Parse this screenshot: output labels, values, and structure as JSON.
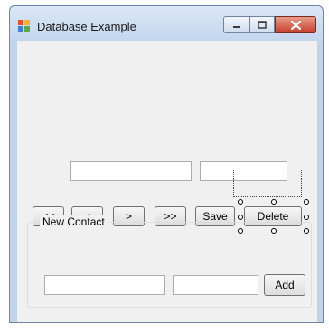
{
  "window": {
    "title": "Database Example",
    "icon": "app-window-icon",
    "controls": [
      "minimize-icon",
      "maximize-icon",
      "close-icon"
    ]
  },
  "record_fields": [
    {
      "value": ""
    },
    {
      "value": ""
    }
  ],
  "navigation": {
    "first_label": "<<",
    "prev_label": "<",
    "next_label": ">",
    "last_label": ">>",
    "save_label": "Save",
    "delete_label": "Delete"
  },
  "new_contact": {
    "group_title": "New Contact",
    "field1_value": "",
    "field2_value": "",
    "add_label": "Add"
  },
  "colors": {
    "client_bg": "#f0f0f0",
    "titlebar": "#c3d6ee",
    "close_button": "#c7402b"
  }
}
